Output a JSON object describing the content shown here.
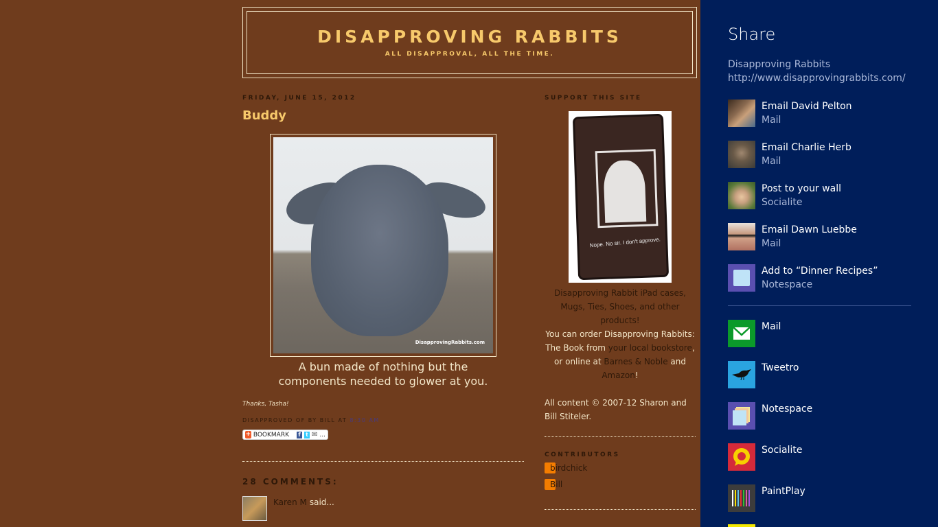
{
  "blog": {
    "title": "DISAPPROVING RABBITS",
    "description": "ALL DISAPPROVAL, ALL THE TIME.",
    "post": {
      "date": "FRIDAY, JUNE 15, 2012",
      "title": "Buddy",
      "image_credit": "DisapprovingRabbits.com",
      "caption_line1": "A bun made of nothing but the",
      "caption_line2": "components needed to glower at you.",
      "thanks": "Thanks, Tasha!",
      "footer_prefix": "DISAPPROVED OF BY BILL AT",
      "footer_time": "8:30 AM",
      "bookmark_label": "BOOKMARK",
      "bookmark_more": "..."
    },
    "comments": {
      "header": "28 COMMENTS:",
      "items": [
        {
          "author": "Karen M",
          "said": "said..."
        }
      ]
    },
    "sidebar": {
      "support_title": "SUPPORT THIS SITE",
      "ipad_text": "Nope. No sir. I don't approve.",
      "products_line1": "Disapproving Rabbit iPad cases,",
      "products_line2": "Mugs, Ties, Shoes, and other",
      "products_line3": "products!",
      "book_line1": "You can order Disapproving Rabbits:",
      "book_line2_prefix": "The Book from ",
      "bookstore_link": "your local bookstore",
      "book_line2_suffix": ",",
      "book_line3_prefix": "or online at ",
      "bn_link": "Barnes & Noble",
      "book_line3_suffix": " and",
      "amazon_link": "Amazon",
      "amazon_suffix": "!",
      "copyright_line1": "All content © 2007-12 Sharon and",
      "copyright_line2": "Bill Stiteler.",
      "contributors_title": "CONTRIBUTORS",
      "contributors": [
        "birdchick",
        "Bill"
      ]
    }
  },
  "share": {
    "title": "Share",
    "page_title": "Disapproving Rabbits",
    "page_url": "http://www.disapprovingrabbits.com/",
    "recent": [
      {
        "label": "Email David Pelton",
        "app": "Mail",
        "icon": "avatar-david-pelton"
      },
      {
        "label": "Email Charlie Herb",
        "app": "Mail",
        "icon": "avatar-charlie-herb"
      },
      {
        "label": "Post to your wall",
        "app": "Socialite",
        "icon": "avatar-user"
      },
      {
        "label": "Email Dawn Luebbe",
        "app": "Mail",
        "icon": "avatar-dawn-luebbe"
      },
      {
        "label": "Add to “Dinner Recipes”",
        "app": "Notespace",
        "icon": "notespace-note-icon"
      }
    ],
    "apps": [
      {
        "label": "Mail",
        "icon": "mail-icon",
        "color": "#0b9a2a"
      },
      {
        "label": "Tweetro",
        "icon": "tweetro-bird-icon",
        "color": "#2aa4e0"
      },
      {
        "label": "Notespace",
        "icon": "notespace-icon",
        "color": "#5a4fb0"
      },
      {
        "label": "Socialite",
        "icon": "socialite-icon",
        "color": "#d42a3a"
      },
      {
        "label": "PaintPlay",
        "icon": "paintplay-icon",
        "color": "#3c3c3c"
      }
    ]
  },
  "colors": {
    "blog_bg": "#6f3c1d",
    "title_gold": "#f7c96b",
    "share_bg": "#001e5a"
  }
}
